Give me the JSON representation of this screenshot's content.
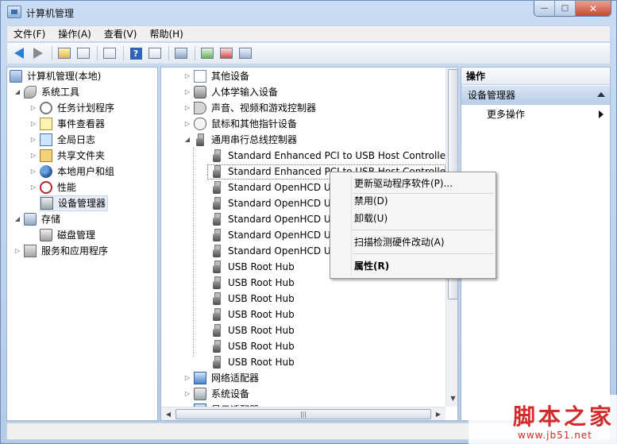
{
  "window": {
    "title": "计算机管理"
  },
  "window_buttons": {
    "min": "—",
    "max": "□",
    "close": "✕"
  },
  "menubar": [
    {
      "label": "文件(F)"
    },
    {
      "label": "操作(A)"
    },
    {
      "label": "查看(V)"
    },
    {
      "label": "帮助(H)"
    }
  ],
  "left_tree": {
    "root": "计算机管理(本地)",
    "system_tools": "系统工具",
    "items": [
      "任务计划程序",
      "事件查看器",
      "全局日志",
      "共享文件夹",
      "本地用户和组",
      "性能",
      "设备管理器"
    ],
    "storage": "存储",
    "disk_management": "磁盘管理",
    "services": "服务和应用程序"
  },
  "device_tree": {
    "categories_top": [
      "其他设备",
      "人体学输入设备",
      "声音、视频和游戏控制器",
      "鼠标和其他指针设备",
      "通用串行总线控制器"
    ],
    "usb_devices": [
      "Standard Enhanced PCI to USB Host Controller",
      "Standard Enhanced PCI to USB Host Controller",
      "Standard OpenHCD US",
      "Standard OpenHCD US",
      "Standard OpenHCD US",
      "Standard OpenHCD US",
      "Standard OpenHCD US",
      "USB Root Hub",
      "USB Root Hub",
      "USB Root Hub",
      "USB Root Hub",
      "USB Root Hub",
      "USB Root Hub",
      "USB Root Hub"
    ],
    "categories_bottom": [
      "网络适配器",
      "系统设备"
    ],
    "partial_bottom": "显示适配器"
  },
  "context_menu": {
    "items": [
      "更新驱动程序软件(P)...",
      "禁用(D)",
      "卸载(U)",
      "扫描检测硬件改动(A)",
      "属性(R)"
    ]
  },
  "actions": {
    "header": "操作",
    "section": "设备管理器",
    "more": "更多操作"
  },
  "watermark": {
    "main": "脚本之家",
    "url": "www.jb51.net"
  }
}
